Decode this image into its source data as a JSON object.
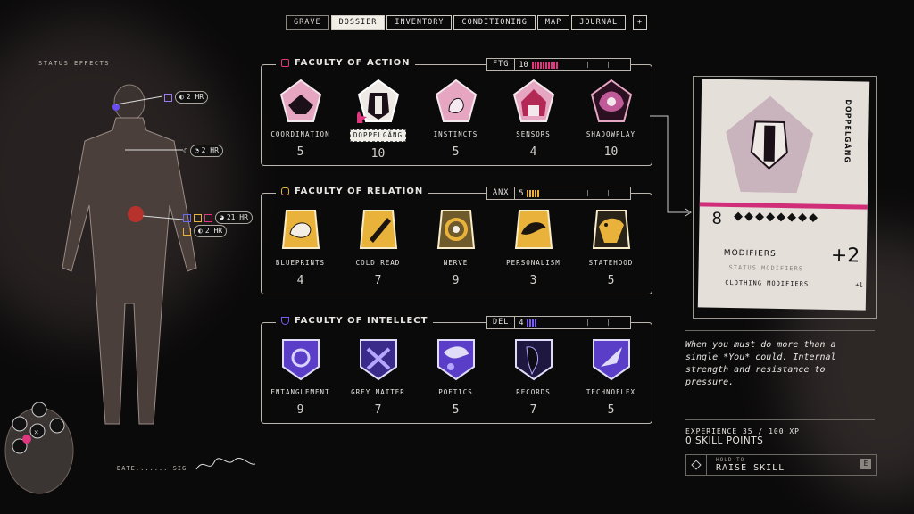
{
  "tabs": [
    {
      "label": "GRAVE"
    },
    {
      "label": "DOSSIER"
    },
    {
      "label": "INVENTORY"
    },
    {
      "label": "CONDITIONING"
    },
    {
      "label": "MAP"
    },
    {
      "label": "JOURNAL"
    },
    {
      "label": "+"
    }
  ],
  "status_effects": {
    "title": "STATUS EFFECTS",
    "items": [
      {
        "time": "2 HR"
      },
      {
        "time": "2 HR"
      },
      {
        "time": "21 HR"
      },
      {
        "time": "2 HR"
      }
    ]
  },
  "signature": {
    "label": "DATE........SIG"
  },
  "faculties": [
    {
      "title": "FACULTY OF ACTION",
      "code": "FTG",
      "value": "10",
      "color": "#e0377f",
      "icon_color": "#e0377f",
      "skills": [
        {
          "name": "COORDINATION",
          "value": "5",
          "icon": "bird-icon"
        },
        {
          "name": "DOPPELGÄNG",
          "value": "10",
          "icon": "goat-icon"
        },
        {
          "name": "INSTINCTS",
          "value": "5",
          "icon": "rabbit-icon"
        },
        {
          "name": "SENSORS",
          "value": "4",
          "icon": "tent-icon"
        },
        {
          "name": "SHADOWPLAY",
          "value": "10",
          "icon": "mask-icon"
        }
      ]
    },
    {
      "title": "FACULTY OF RELATION",
      "code": "ANX",
      "value": "5",
      "color": "#e9b23a",
      "icon_color": "#e9b23a",
      "skills": [
        {
          "name": "BLUEPRINTS",
          "value": "4",
          "icon": "bird-icon"
        },
        {
          "name": "COLD READ",
          "value": "7",
          "icon": "hand-icon"
        },
        {
          "name": "NERVE",
          "value": "9",
          "icon": "key-icon"
        },
        {
          "name": "PERSONALISM",
          "value": "3",
          "icon": "dolphin-icon"
        },
        {
          "name": "STATEHOOD",
          "value": "5",
          "icon": "eagle-icon"
        }
      ]
    },
    {
      "title": "FACULTY OF INTELLECT",
      "code": "DEL",
      "value": "4",
      "color": "#7c5cf0",
      "icon_color": "#7c5cf0",
      "skills": [
        {
          "name": "ENTANGLEMENT",
          "value": "9",
          "icon": "orbit-icon"
        },
        {
          "name": "GREY MATTER",
          "value": "7",
          "icon": "brain-icon"
        },
        {
          "name": "POETICS",
          "value": "5",
          "icon": "butterfly-icon"
        },
        {
          "name": "RECORDS",
          "value": "7",
          "icon": "crow-icon"
        },
        {
          "name": "TECHNOFLEX",
          "value": "5",
          "icon": "rocket-icon"
        }
      ]
    }
  ],
  "card": {
    "name": "DOPPELGÄNG",
    "level": "8",
    "pips": 8,
    "modifiers_label": "MODIFIERS",
    "modifiers_value": "+2",
    "status_modifiers": "STATUS MODIFIERS",
    "clothing_modifiers": "CLOTHING MODIFIERS",
    "clothing_value": "+1"
  },
  "description": "When you must do more than a single *You* could. Internal strength and resistance to pressure.",
  "experience": "EXPERIENCE 35 / 100 XP",
  "skill_points": "0 SKILL POINTS",
  "hold": {
    "small": "HOLD TO",
    "label": "RAISE SKILL",
    "key": "E"
  }
}
